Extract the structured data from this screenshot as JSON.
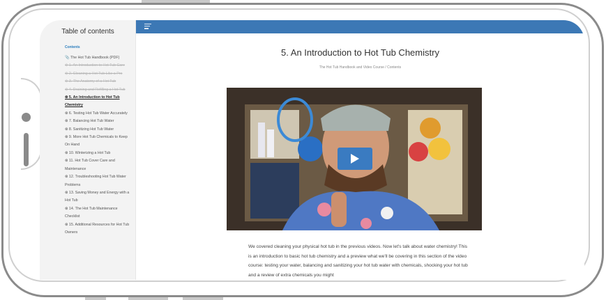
{
  "toc": {
    "title": "Table of contents",
    "heading": "Contents",
    "items": [
      {
        "label": "📎 The Hot Tub Handbook (PDF)",
        "state": "normal"
      },
      {
        "label": "⊗ 1. An Introduction to Hot Tub Care",
        "state": "done"
      },
      {
        "label": "⊗ 2. Cleaning a Hot Tub Like a Pro",
        "state": "done"
      },
      {
        "label": "⊗ 3. The Anatomy of a Hot Tub",
        "state": "done"
      },
      {
        "label": "⊗ 4. Draining and Refilling a Hot Tub",
        "state": "done"
      },
      {
        "label": "⊗ 5. An Introduction to Hot Tub Chemistry",
        "state": "current"
      },
      {
        "label": "⊗ 6. Testing Hot Tub Water Accurately",
        "state": "normal"
      },
      {
        "label": "⊗ 7. Balancing Hot Tub Water",
        "state": "normal"
      },
      {
        "label": "⊗ 8. Sanitizing Hot Tub Water",
        "state": "normal"
      },
      {
        "label": "⊗ 9. More Hot Tub Chemicals to Keep On Hand",
        "state": "normal"
      },
      {
        "label": "⊗ 10. Winterizing a Hot Tub",
        "state": "normal"
      },
      {
        "label": "⊗ 11. Hot Tub Cover Care and Maintenance",
        "state": "normal"
      },
      {
        "label": "⊗ 12. Troubleshooting Hot Tub Water Problems",
        "state": "normal"
      },
      {
        "label": "⊗ 13. Saving Money and Energy with a Hot Tub",
        "state": "normal"
      },
      {
        "label": "⊗ 14. The Hot Tub Maintenance Checklist",
        "state": "normal"
      },
      {
        "label": "⊗ 15. Additional Resources for Hot Tub Owners",
        "state": "normal"
      }
    ]
  },
  "page": {
    "title": "5. An Introduction to Hot Tub Chemistry",
    "breadcrumb": "The Hot Tub Handbook and Video Course  /  Contents",
    "body": "We covered cleaning your physical hot tub in the previous videos. Now let's talk about water chemistry! This is an introduction to basic hot tub chemistry and a preview what we'll be covering in this section of the video course: testing your water, balancing and sanitizing your hot tub water with chemicals, shocking your hot tub and a review of extra chemicals you might"
  },
  "colors": {
    "topbar": "#3c78b5",
    "accent": "#2a7dbd",
    "play_button": "#2d78c8"
  }
}
